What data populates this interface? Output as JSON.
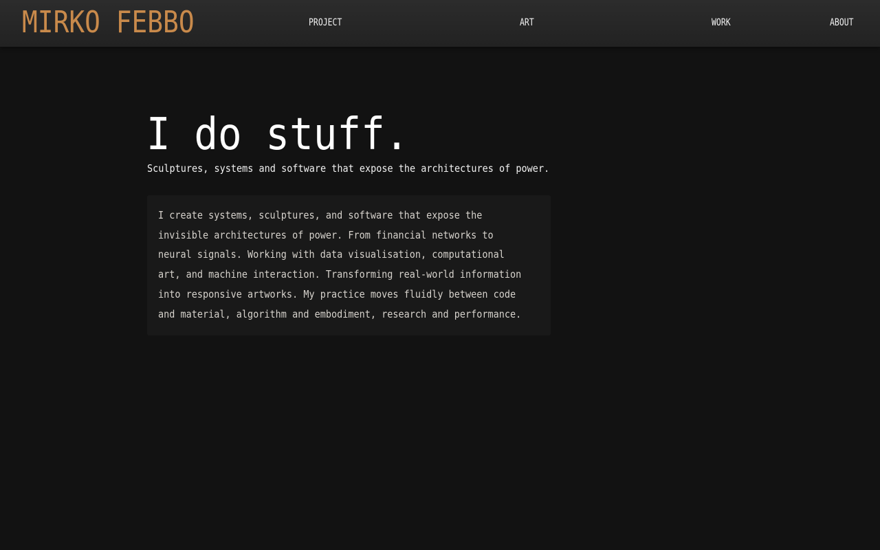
{
  "header": {
    "brand": "MIRKO FEBBO",
    "nav": [
      {
        "label": "PROJECT"
      },
      {
        "label": "ART"
      },
      {
        "label": "WORK"
      },
      {
        "label": "ABOUT"
      }
    ]
  },
  "hero": {
    "title": "I do stuff.",
    "subtitle": "Sculptures, systems and software that expose the architectures of power."
  },
  "bio": {
    "lines": [
      "I create systems, sculptures, and software that expose the",
      "invisible architectures of power. From financial networks to",
      "neural signals. Working with data visualisation, computational",
      "art, and machine interaction. Transforming real-world information",
      "into responsive artworks. My practice moves fluidly between code",
      "and material, algorithm and embodiment, research and performance."
    ]
  },
  "colors": {
    "background": "#121212",
    "header": "#262626",
    "brand": "#c98a4b",
    "card": "#191919",
    "text": "#ffffff",
    "body_text": "#d6d2cc"
  }
}
